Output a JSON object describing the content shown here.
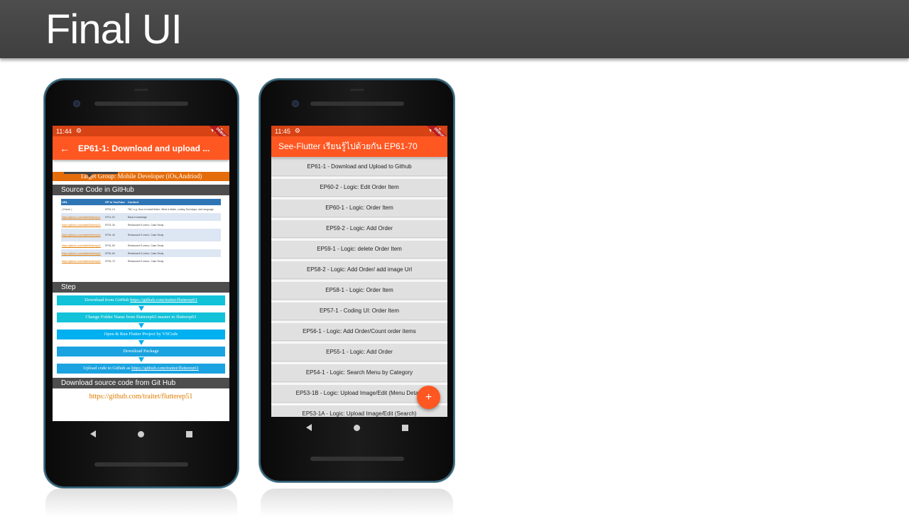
{
  "slide": {
    "title": "Final UI"
  },
  "phone1": {
    "status_time": "11:44",
    "app_title": "EP61-1: Download and upload ...",
    "target_group": "Target Group: Mobile Developer (iOs,Andriod)",
    "section_source": "Source Code in GitHub",
    "table_headers": [
      "URL",
      "EP in YouTube",
      "Content"
    ],
    "table_rows": [
      [
        "( Future )",
        "EP01-10",
        "TBC e.g. How to install flutter, What is flutter, coding Technique, dart language"
      ],
      [
        "https://github.com/traitet/flutterep11",
        "EP11-20",
        "Basic Knowledge"
      ],
      [
        "https://github.com/traitet/flutterep21",
        "EP21-30",
        "Restaurant E-menu: Case Study"
      ],
      [
        "https://github.com/traitet/flutterep31",
        "EP31-40",
        "Restaurant E-menu: Case Study"
      ],
      [
        "https://github.com/traitet/flutterep41",
        "EP41-50",
        "Restaurant E-menu: Case Study"
      ],
      [
        "https://github.com/traitet/flutterep51",
        "EP51-60",
        "Restaurant E-menu: Case Study"
      ],
      [
        "https://github.com/traitet/flutterep61",
        "EP61-70",
        "Restaurant E-menu: Case Study"
      ]
    ],
    "section_step": "Step",
    "steps": {
      "s1_text": "Download from GitHub ",
      "s1_link": "https://github.com/traitet/flutterep61",
      "s2": "Change Folder Name from flutterep61-master to flutterep61",
      "s3": "Open & Run Flutter Project by VSCode",
      "s4": "Download Package",
      "s5_text": "Upload code to Github as ",
      "s5_link": "https://github.com/traitet/flutterep61"
    },
    "section_download": "Download source code from Git Hub",
    "download_link": "https://github.com/traitet/flutterep51"
  },
  "phone2": {
    "status_time": "11:45",
    "app_title": "See-Flutter เรียนรู้ไปด้วยกัน EP61-70",
    "items": [
      "EP61-1 - Download and Upload to Github",
      "EP60-2 - Logic: Edit Order Item",
      "EP60-1 - Logic: Order Item",
      "EP59-2 - Logic: Add Order",
      "EP59-1 - Logic: delete Order Item",
      "EP58-2 - Logic: Add Order/ add image Url",
      "EP58-1 - Logic: Order Item",
      "EP57-1 - Coding UI: Order Item",
      "EP56-1 - Logic: Add Order/Count order items",
      "EP55-1 - Logic: Add Order",
      "EP54-1 - Logic: Search Menu by Category",
      "EP53-1B - Logic: Upload Image/Edit (Menu Detail)",
      "EP53-1A - Logic: Upload Image/Edit (Search)"
    ],
    "fab_label": "+"
  },
  "colors": {
    "accent": "#ff5722",
    "status": "#d84315",
    "section": "#4d4d4d",
    "step": "#00b0f0"
  },
  "icons": [
    "back-arrow-icon",
    "gear-icon",
    "wifi-icon",
    "signal-icon",
    "battery-icon",
    "add-icon",
    "nav-back-icon",
    "nav-home-icon",
    "nav-recent-icon"
  ]
}
